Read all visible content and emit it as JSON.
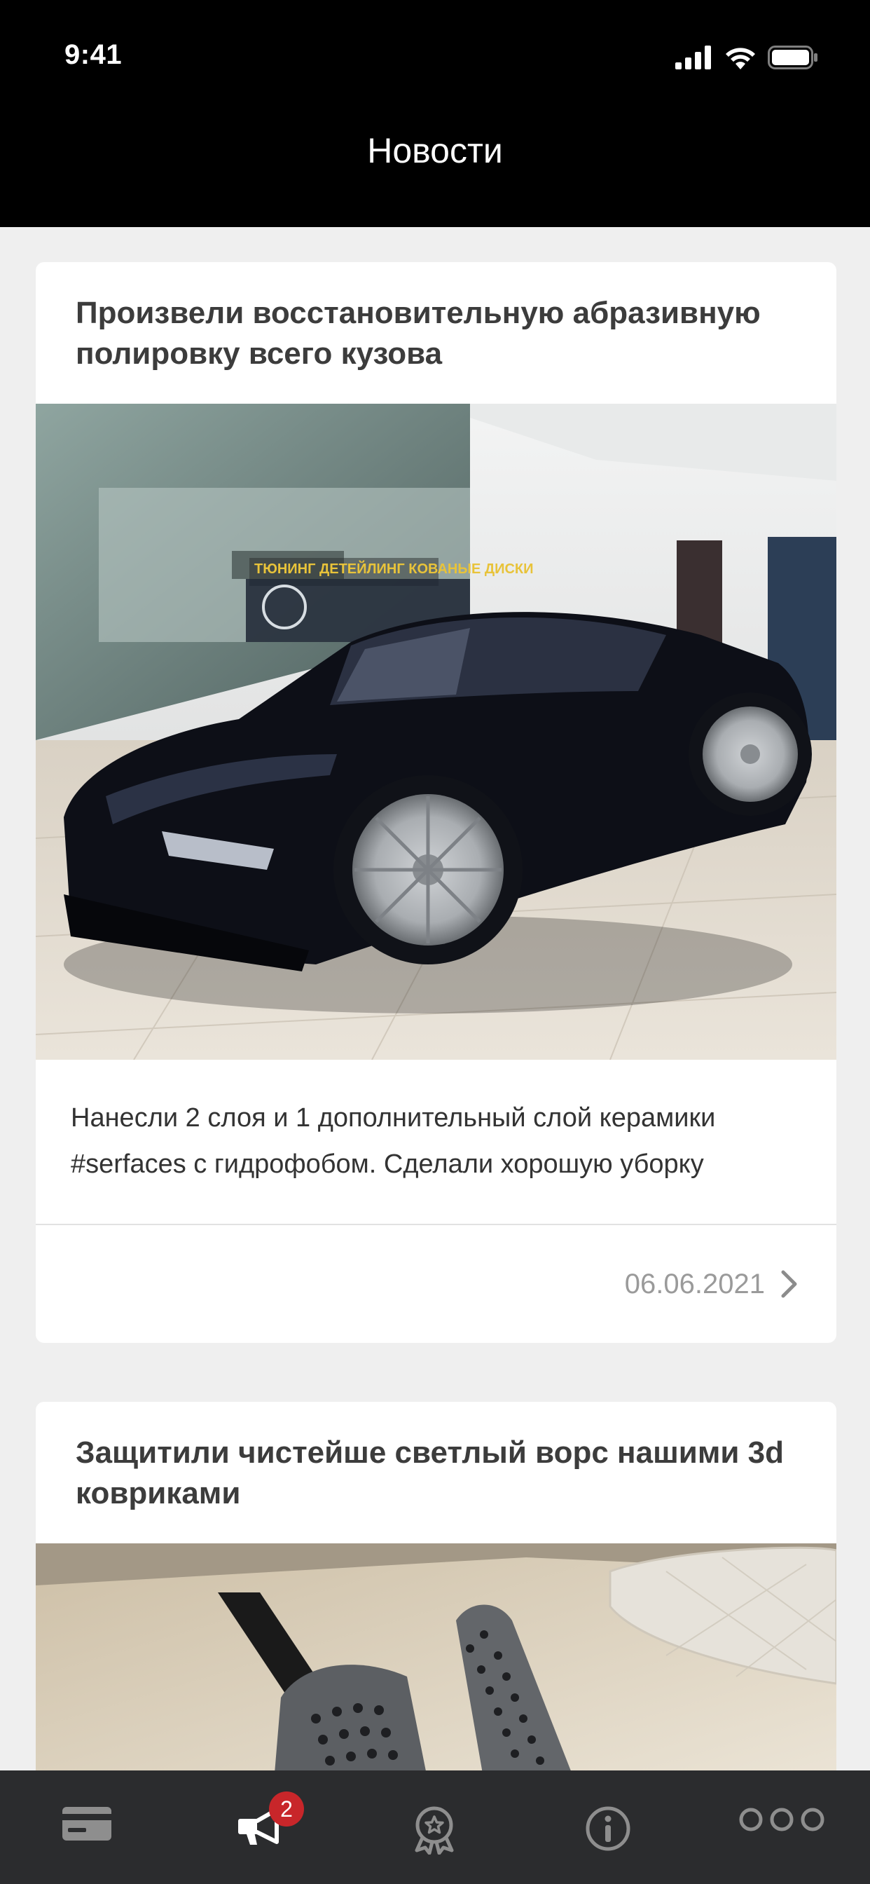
{
  "status_bar": {
    "time": "9:41"
  },
  "header": {
    "title": "Новости"
  },
  "news": [
    {
      "title": "Произвели восстановительную абразивную полировку всего кузова",
      "image": "black-sports-car-in-showroom",
      "image_signage": "ТЮНИНГ   ДЕТЕЙЛИНГ   КОВАНЫЕ ДИСКИ",
      "text": "Нанесли 2 слоя и 1 дополнительный слой керамики #serfaces с гидрофобом. Сделали хорошую уборку",
      "date": "06.06.2021"
    },
    {
      "title": "Защитили чистейше светлый ворс нашими 3d ковриками",
      "image": "car-pedals-on-light-carpet"
    }
  ],
  "tabbar": {
    "items": [
      {
        "name": "card",
        "icon": "card-icon"
      },
      {
        "name": "news",
        "icon": "megaphone-icon",
        "badge": "2",
        "active": true
      },
      {
        "name": "rewards",
        "icon": "award-icon"
      },
      {
        "name": "info",
        "icon": "info-icon"
      },
      {
        "name": "more",
        "icon": "more-icon"
      }
    ]
  },
  "colors": {
    "header_bg": "#000000",
    "page_bg": "#efefef",
    "tabbar_bg": "#2b2c2e",
    "badge": "#c8262a",
    "tab_inactive": "#8e8e8e"
  }
}
